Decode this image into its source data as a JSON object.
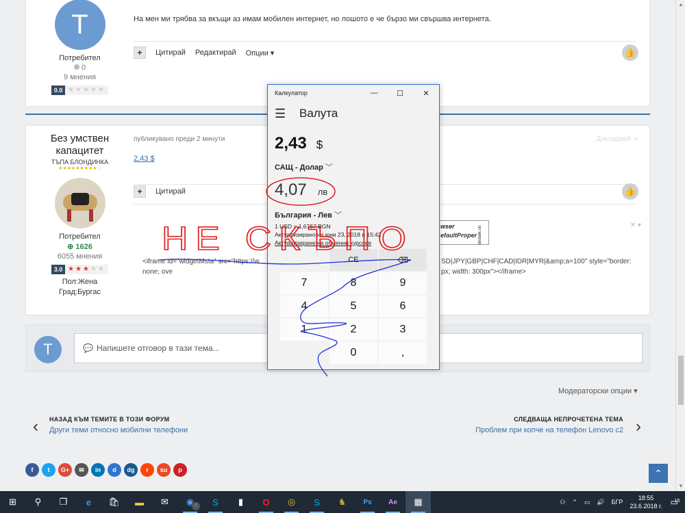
{
  "post1": {
    "avatar_letter": "T",
    "text": "На мен ми трябва за вкъщи аз имам мобилен интернет, но лошото е че бързо ми свършва интернета.",
    "role": "Потребител",
    "reputation": "0",
    "posts_count": "9 мнения",
    "rating_score": "0.0",
    "actions": [
      "Цитирай",
      "Редактирай",
      "Опции"
    ]
  },
  "post2": {
    "username_line1": "Без умствен",
    "username_line2": "капацитет",
    "user_title": "ТЪПА БЛОНДИНКА",
    "meta": "публикувано преди 2 минути",
    "share_label": "Докладвай",
    "content": "2,43 $",
    "role": "Потребител",
    "reputation": "1626",
    "posts_count": "6055 мнения",
    "rating_score": "3.0",
    "gender": "Пол:Жена",
    "city": "Град:Бургас",
    "action_quote": "Цитирай",
    "iframe_left": "<iframe id=\"widgetMsta\" src=\"https://w",
    "iframe_left2": "none; ove",
    "iframe_right": "SD|JPY|GBP|CHF|CAD|IDR|MYR|&amp;a=100\" style=\"border:",
    "iframe_right2": "px; width: 300px\"></iframe>",
    "widget_line1": "wser",
    "widget_line2": "efaultProper",
    "widget_side": "dnsbek.ch"
  },
  "calc": {
    "title": "Калкулатор",
    "mode": "Валута",
    "value_from": "2,43",
    "unit_from": "$",
    "currency_from": "САЩ - Долар",
    "value_to": "4,07",
    "unit_to": "лв",
    "currency_to": "България - Лев",
    "rate": "1 USD = 1,6767 BGN",
    "updated": "Актуализирано на юни 23, 2018 в 15:42",
    "update_link": "Актуализиране на обменни курсове",
    "keys": {
      "ce": "CE",
      "back": "⌫",
      "k7": "7",
      "k8": "8",
      "k9": "9",
      "k4": "4",
      "k5": "5",
      "k6": "6",
      "k1": "1",
      "k2": "2",
      "k3": "3",
      "k0": "0",
      "comma": ","
    }
  },
  "annotation": "НЕ СКЪПО",
  "reply": {
    "avatar_letter": "T",
    "placeholder": "Напишете отговор в тази тема..."
  },
  "moderator_options": "Модераторски опции",
  "nav": {
    "prev_label": "НАЗАД КЪМ ТЕМИТЕ В ТОЗИ ФОРУМ",
    "prev_sub": "Други теми относно мобилни телефони",
    "next_label": "СЛЕДВАЩА НЕПРОЧЕТЕНА ТЕМА",
    "next_sub": "Проблем при копче на телефон Lenovo c2"
  },
  "share_icons": [
    {
      "name": "facebook-icon",
      "label": "f",
      "color": "#3b5998"
    },
    {
      "name": "twitter-icon",
      "label": "t",
      "color": "#1da1f2"
    },
    {
      "name": "googleplus-icon",
      "label": "G+",
      "color": "#dd4b39"
    },
    {
      "name": "email-icon",
      "label": "✉",
      "color": "#555555"
    },
    {
      "name": "linkedin-icon",
      "label": "in",
      "color": "#0077b5"
    },
    {
      "name": "delicious-icon",
      "label": "d",
      "color": "#3274d1"
    },
    {
      "name": "digg-icon",
      "label": "dg",
      "color": "#1b5891"
    },
    {
      "name": "reddit-icon",
      "label": "r",
      "color": "#ff4500"
    },
    {
      "name": "stumbleupon-icon",
      "label": "su",
      "color": "#eb4924"
    },
    {
      "name": "pinterest-icon",
      "label": "p",
      "color": "#cb2027"
    }
  ],
  "taskbar": {
    "notification_badge": "6",
    "language": "БГР",
    "time": "18:55",
    "date": "23.6.2018 г.",
    "action_center_badge": "15"
  },
  "colors": {
    "accent": "#3b73b3",
    "calc_border": "#2c6bd1",
    "annotation_red": "#e02020",
    "annotation_blue": "#1a2fd6"
  }
}
